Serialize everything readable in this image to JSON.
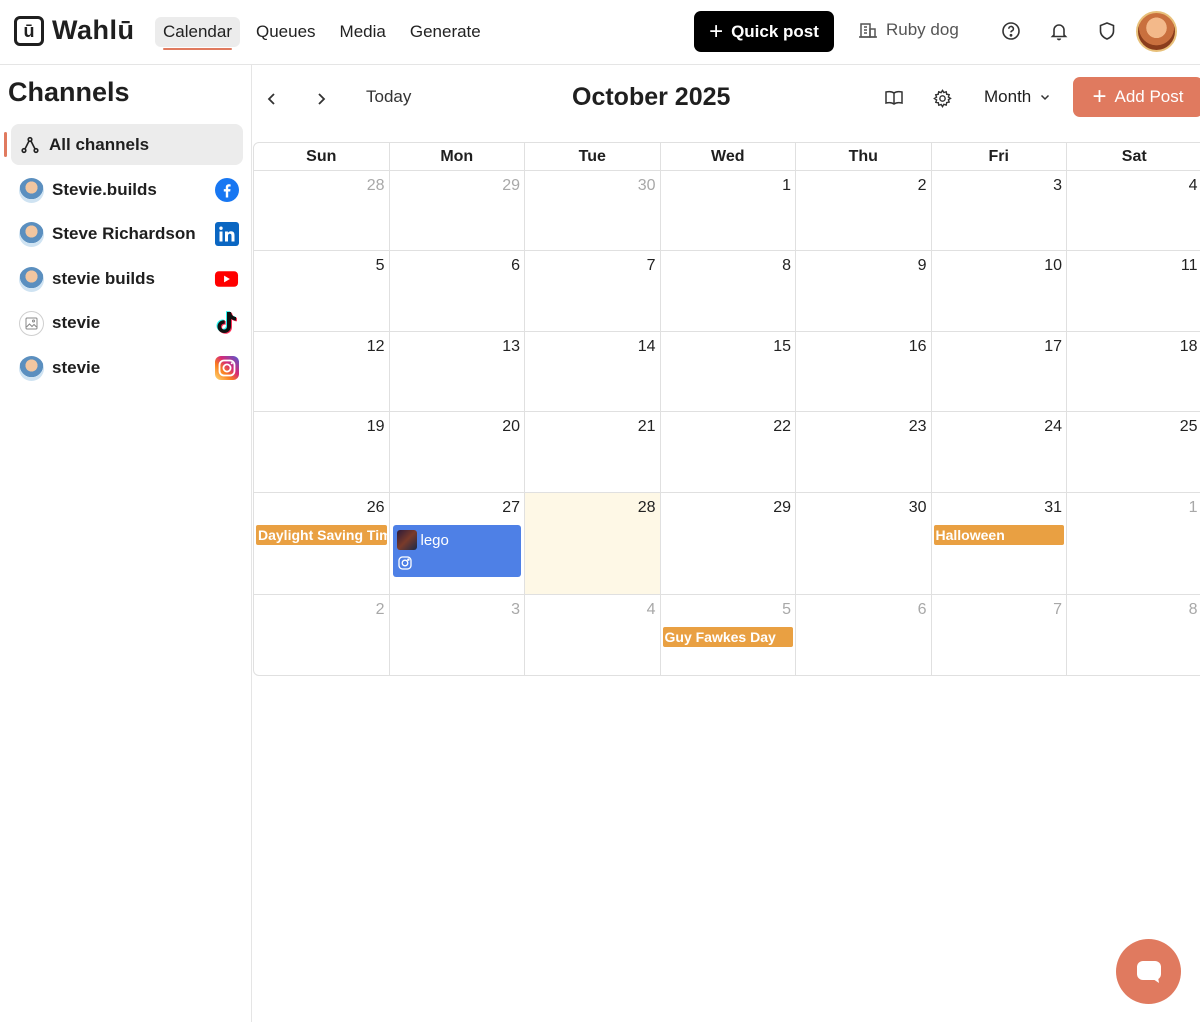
{
  "app": {
    "logo_mark": "ū",
    "logo_text": "Wahlū"
  },
  "nav": {
    "items": [
      "Calendar",
      "Queues",
      "Media",
      "Generate"
    ],
    "active": "Calendar"
  },
  "toolbar": {
    "quick_post_label": "Quick post",
    "workspace_name": "Ruby dog"
  },
  "sidebar": {
    "title": "Channels",
    "all_label": "All channels",
    "channels": [
      {
        "name": "Stevie.builds",
        "network": "facebook"
      },
      {
        "name": "Steve Richardson",
        "network": "linkedin"
      },
      {
        "name": "stevie builds",
        "network": "youtube"
      },
      {
        "name": "stevie",
        "network": "tiktok"
      },
      {
        "name": "stevie",
        "network": "instagram"
      }
    ]
  },
  "calendar": {
    "today_label": "Today",
    "month_title": "October 2025",
    "view_label": "Month",
    "add_post_label": "Add Post",
    "weekdays": [
      "Sun",
      "Mon",
      "Tue",
      "Wed",
      "Thu",
      "Fri",
      "Sat"
    ],
    "weeks": [
      [
        "28",
        "29",
        "30",
        "1",
        "2",
        "3",
        "4"
      ],
      [
        "5",
        "6",
        "7",
        "8",
        "9",
        "10",
        "11"
      ],
      [
        "12",
        "13",
        "14",
        "15",
        "16",
        "17",
        "18"
      ],
      [
        "19",
        "20",
        "21",
        "22",
        "23",
        "24",
        "25"
      ],
      [
        "26",
        "27",
        "28",
        "29",
        "30",
        "31",
        "1"
      ],
      [
        "2",
        "3",
        "4",
        "5",
        "6",
        "7",
        "8"
      ]
    ],
    "events": {
      "daylight_saving": "Daylight Saving Time ends",
      "halloween": "Halloween",
      "guy_fawkes": "Guy Fawkes Day"
    },
    "posts": [
      {
        "title": "lego",
        "network": "instagram"
      }
    ]
  },
  "colors": {
    "accent": "#e07a5f",
    "holiday": "#e9a042",
    "post": "#4e80e6",
    "today_bg": "#fef8e6"
  }
}
